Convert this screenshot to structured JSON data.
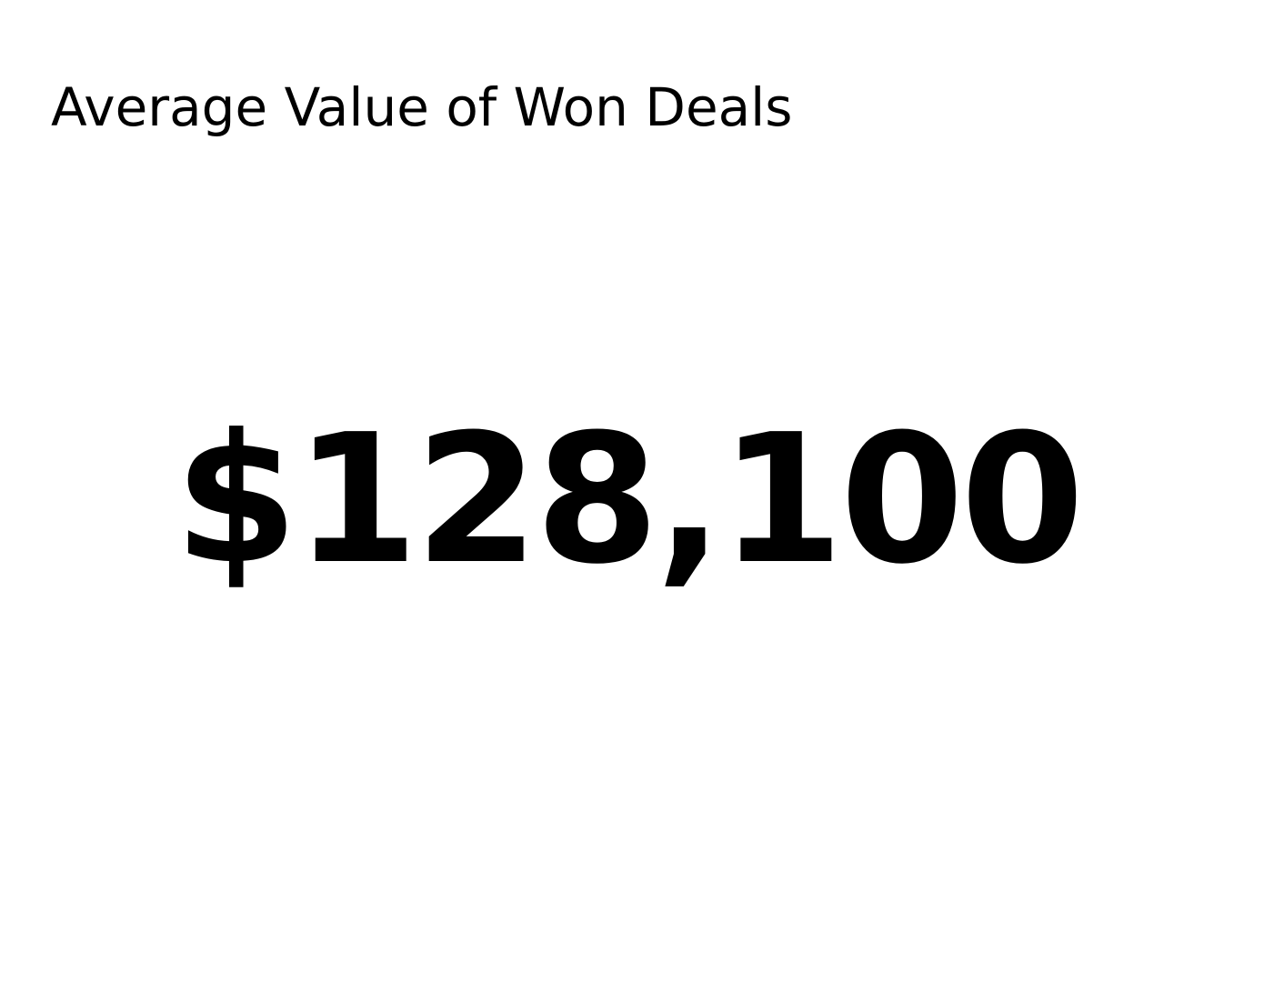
{
  "metric_card": {
    "title": "Average Value of Won Deals",
    "value": "$128,100"
  },
  "colors": {
    "background": "#ffffff",
    "text": "#000000"
  }
}
